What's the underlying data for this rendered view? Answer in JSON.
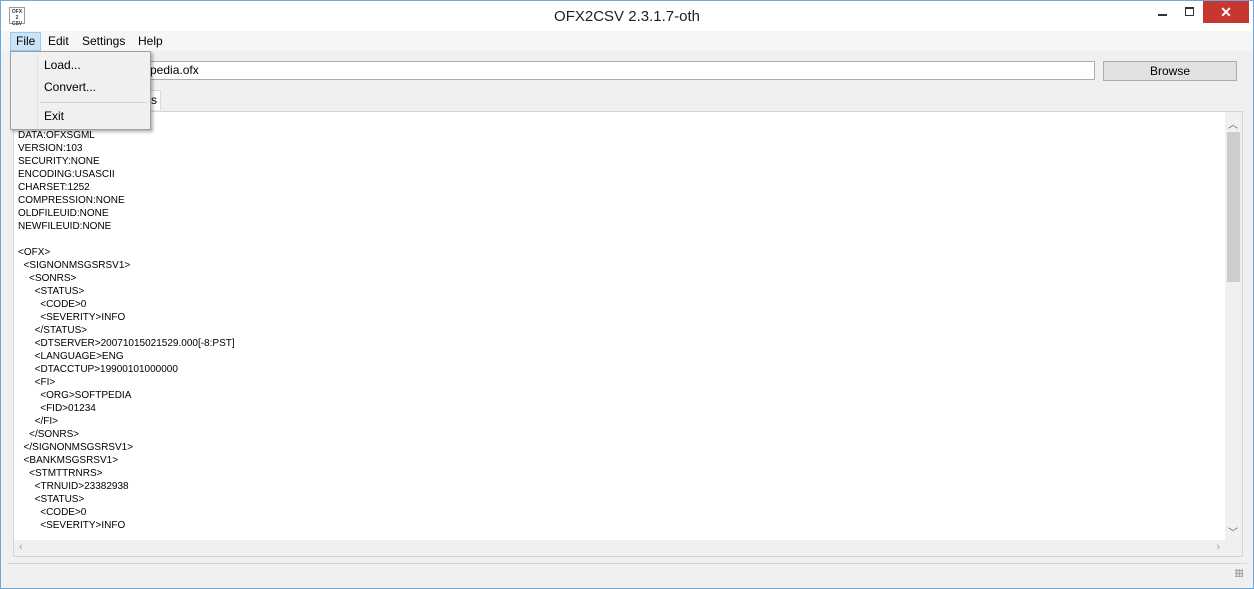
{
  "window": {
    "title": "OFX2CSV 2.3.1.7-oth",
    "icon_text": "OFX\n2\nCSV",
    "close_glyph": "✕"
  },
  "menu": {
    "file": "File",
    "edit": "Edit",
    "settings": "Settings",
    "help": "Help"
  },
  "file_menu": {
    "load": "Load...",
    "convert": "Convert...",
    "exit": "Exit"
  },
  "path": {
    "value": "pedia.ofx"
  },
  "browse_label": "Browse",
  "tab_label": "s",
  "editor": {
    "content": "DATA:OFXSGML\nVERSION:103\nSECURITY:NONE\nENCODING:USASCII\nCHARSET:1252\nCOMPRESSION:NONE\nOLDFILEUID:NONE\nNEWFILEUID:NONE\n\n<OFX>\n  <SIGNONMSGSRSV1>\n    <SONRS>\n      <STATUS>\n        <CODE>0\n        <SEVERITY>INFO\n      </STATUS>\n      <DTSERVER>20071015021529.000[-8:PST]\n      <LANGUAGE>ENG\n      <DTACCTUP>19900101000000\n      <FI>\n        <ORG>SOFTPEDIA\n        <FID>01234\n      </FI>\n    </SONRS>\n  </SIGNONMSGSRSV1>\n  <BANKMSGSRSV1>\n    <STMTTRNRS>\n      <TRNUID>23382938\n      <STATUS>\n        <CODE>0\n        <SEVERITY>INFO"
  },
  "icons": {
    "up": "chevron-up-icon",
    "down": "chevron-down-icon",
    "left": "chevron-left-icon",
    "right": "chevron-right-icon"
  },
  "colors": {
    "close_button": "#c7372f",
    "menu_highlight": "#cce4f7",
    "window_border": "#6aa9e0"
  }
}
